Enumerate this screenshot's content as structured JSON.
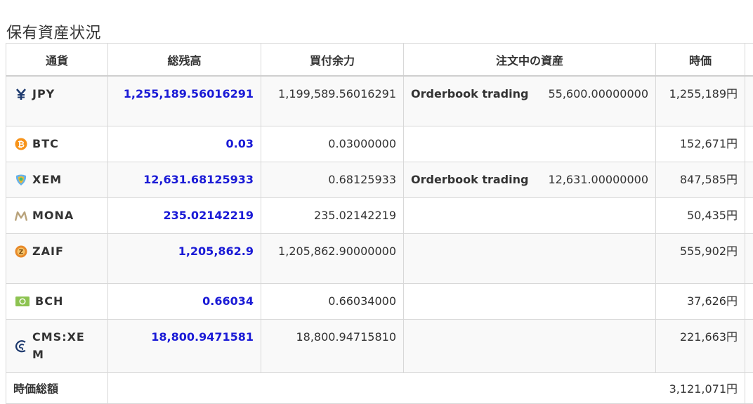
{
  "page": {
    "title": "保有資産状況"
  },
  "table": {
    "headers": [
      "通貨",
      "総残高",
      "買付余力",
      "注文中の資産",
      "時価"
    ],
    "rows": [
      {
        "currency": "JPY",
        "icon": "yen-icon",
        "total": "1,255,189.5601629​1",
        "available": "1,199,589.5601629​1",
        "order_label": "Orderbook trading",
        "order_value": "55,600.00000000",
        "price": "1,255,189円"
      },
      {
        "currency": "BTC",
        "icon": "bitcoin-icon",
        "total": "0.03",
        "available": "0.03000000",
        "order_label": "",
        "order_value": "",
        "price": "152,671円"
      },
      {
        "currency": "XEM",
        "icon": "nem-icon",
        "total": "12,631.68125933",
        "available": "0.68125933",
        "order_label": "Orderbook trading",
        "order_value": "12,631.00000000",
        "price": "847,585円"
      },
      {
        "currency": "MONA",
        "icon": "monacoin-icon",
        "total": "235.02142219",
        "available": "235.02142219",
        "order_label": "",
        "order_value": "",
        "price": "50,435円"
      },
      {
        "currency": "ZAIF",
        "icon": "zaif-icon",
        "total": "1,205,862.9",
        "available": "1,205,862.9000000​0",
        "order_label": "",
        "order_value": "",
        "price": "555,902円"
      },
      {
        "currency": "BCH",
        "icon": "bitcoin-cash-icon",
        "total": "0.66034",
        "available": "0.66034000",
        "order_label": "",
        "order_value": "",
        "price": "37,626円"
      },
      {
        "currency": "CMS:XEM",
        "icon": "cms-icon",
        "total": "18,800.9471581",
        "available": "18,800.94715810",
        "order_label": "",
        "order_value": "",
        "price": "221,663円"
      }
    ],
    "footer": {
      "label": "時価総額",
      "value": "3,121,071円"
    }
  },
  "colors": {
    "total_text": "#1a1ad6",
    "row_alt": "#f9f9f9",
    "border": "#d8d8d8"
  }
}
